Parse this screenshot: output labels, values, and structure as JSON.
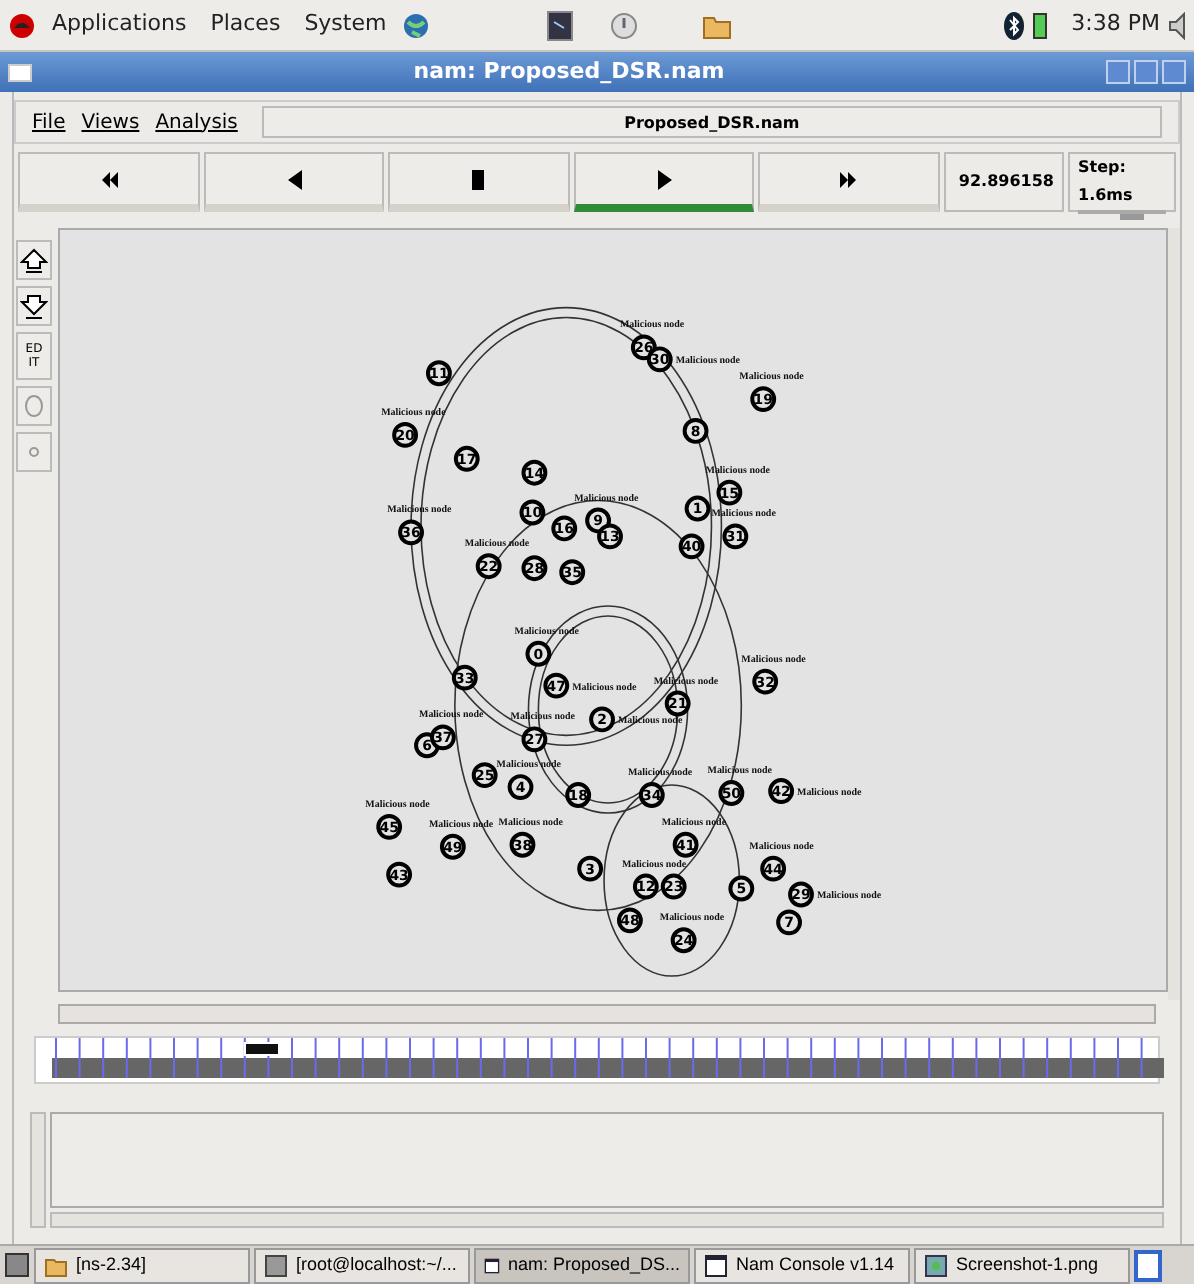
{
  "top_panel": {
    "menus": [
      "Applications",
      "Places",
      "System"
    ],
    "clock": "3:38 PM"
  },
  "window": {
    "title": "nam: Proposed_DSR.nam"
  },
  "menu": [
    "File",
    "Views",
    "Analysis"
  ],
  "file_name": "Proposed_DSR.nam",
  "controls": [
    {
      "kind": "rewind",
      "selected": false
    },
    {
      "kind": "back",
      "selected": false
    },
    {
      "kind": "stop",
      "selected": false
    },
    {
      "kind": "play",
      "selected": true
    },
    {
      "kind": "forward",
      "selected": false
    }
  ],
  "time": "92.896158",
  "step": "Step: 1.6ms",
  "step_slider": {
    "level": 0.6
  },
  "tools": [
    {
      "kind": "zoom-in"
    },
    {
      "kind": "zoom-out"
    },
    {
      "kind": "edit",
      "label": "ED IT"
    },
    {
      "kind": "oval"
    },
    {
      "kind": "dot"
    }
  ],
  "nodes": [
    {
      "label": "11"
    },
    {
      "label": "20",
      "tag": "Malicious node"
    },
    {
      "label": "17"
    },
    {
      "label": "14"
    },
    {
      "label": "36",
      "tag": "Malicious node"
    },
    {
      "label": "10"
    },
    {
      "label": "16"
    },
    {
      "label": "9",
      "tag": "Malicious node"
    },
    {
      "label": "13"
    },
    {
      "label": "22",
      "tag": "Malicious node"
    },
    {
      "label": "28"
    },
    {
      "label": "35"
    },
    {
      "label": "26",
      "tag": "Malicious node"
    },
    {
      "label": "30",
      "tag": "Malicious node"
    },
    {
      "label": "8"
    },
    {
      "label": "19",
      "tag": "Malicious node"
    },
    {
      "label": "15",
      "tag": "Malicious node"
    },
    {
      "label": "1"
    },
    {
      "label": "31",
      "tag": "Malicious node"
    },
    {
      "label": "40"
    },
    {
      "label": "0",
      "tag": "Malicious node"
    },
    {
      "label": "33"
    },
    {
      "label": "47",
      "tag": "Malicious node"
    },
    {
      "label": "27",
      "tag": "Malicious node"
    },
    {
      "label": "2",
      "tag": "Malicious node"
    },
    {
      "label": "21",
      "tag": "Malicious node"
    },
    {
      "label": "32",
      "tag": "Malicious node"
    },
    {
      "label": "6"
    },
    {
      "label": "37",
      "tag": "Malicious node"
    },
    {
      "label": "25"
    },
    {
      "label": "4",
      "tag": "Malicious node"
    },
    {
      "label": "18"
    },
    {
      "label": "34",
      "tag": "Malicious node"
    },
    {
      "label": "50",
      "tag": "Malicious node"
    },
    {
      "label": "42",
      "tag": "Malicious node"
    },
    {
      "label": "45",
      "tag": "Malicious node"
    },
    {
      "label": "43"
    },
    {
      "label": "49",
      "tag": "Malicious node"
    },
    {
      "label": "38",
      "tag": "Malicious node"
    },
    {
      "label": "3"
    },
    {
      "label": "41",
      "tag": "Malicious node"
    },
    {
      "label": "12",
      "tag": "Malicious node"
    },
    {
      "label": "23"
    },
    {
      "label": "5"
    },
    {
      "label": "48"
    },
    {
      "label": "24",
      "tag": "Malicious node"
    },
    {
      "label": "44",
      "tag": "Malicious node"
    },
    {
      "label": "29",
      "tag": "Malicious node"
    },
    {
      "label": "7"
    }
  ],
  "taskbar": [
    {
      "label": "[ns-2.34]",
      "kind": "folder",
      "selected": false
    },
    {
      "label": "[root@localhost:~/...",
      "kind": "terminal",
      "selected": false
    },
    {
      "label": "nam: Proposed_DS...",
      "kind": "window",
      "selected": true
    },
    {
      "label": "Nam Console v1.14",
      "kind": "window",
      "selected": false
    },
    {
      "label": "Screenshot-1.png",
      "kind": "image",
      "selected": false
    }
  ]
}
